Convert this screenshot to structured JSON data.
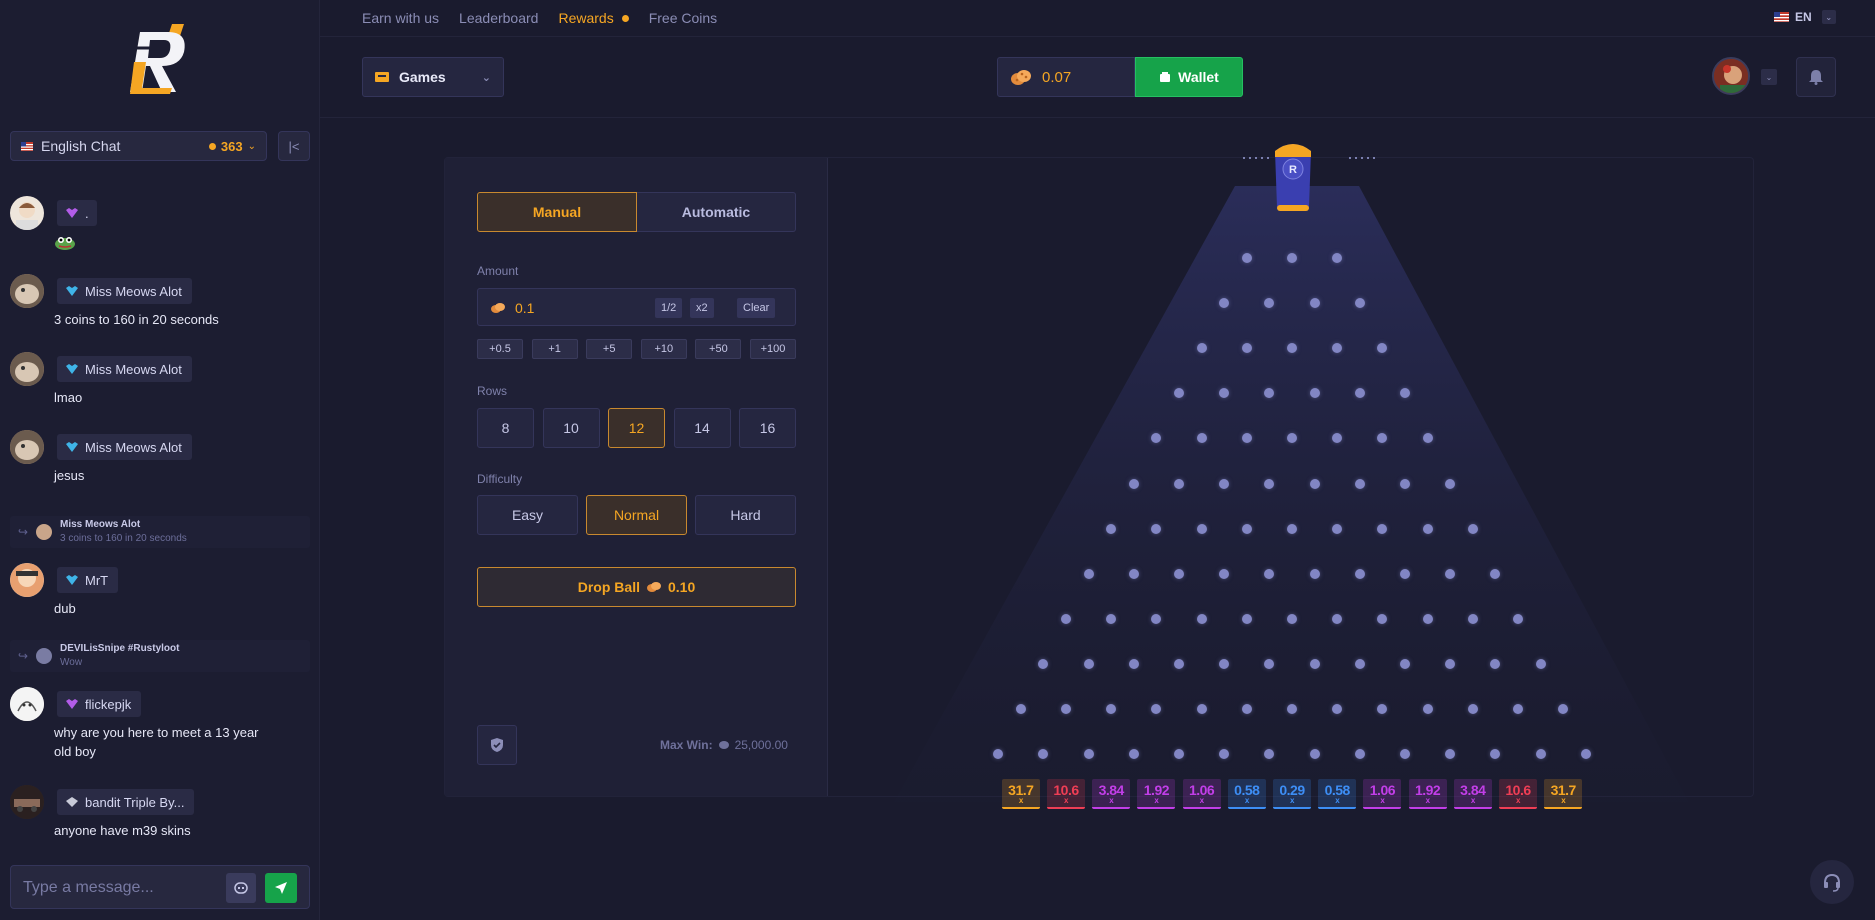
{
  "nav": {
    "links": [
      {
        "label": "Earn with us",
        "active": false
      },
      {
        "label": "Leaderboard",
        "active": false
      },
      {
        "label": "Rewards",
        "active": true
      },
      {
        "label": "Free Coins",
        "active": false
      }
    ],
    "language": "EN"
  },
  "header": {
    "games_label": "Games",
    "balance": "0.07",
    "wallet_label": "Wallet"
  },
  "chat": {
    "room_label": "English Chat",
    "online_count": "363",
    "input_placeholder": "Type a message...",
    "messages": [
      {
        "name": ".",
        "text": "",
        "badge": "purple"
      },
      {
        "name": "Miss Meows Alot",
        "text": "3 coins to 160 in 20 seconds",
        "badge": "blue"
      },
      {
        "name": "Miss Meows Alot",
        "text": "lmao",
        "badge": "blue"
      },
      {
        "name": "Miss Meows Alot",
        "text": "jesus",
        "badge": "blue"
      },
      {
        "name": "MrT",
        "text": "dub",
        "badge": "blue"
      },
      {
        "name": "flickepjk",
        "text": "why are you here to meet a 13 year old boy",
        "badge": "purple"
      },
      {
        "name": "bandit Triple By...",
        "text": "anyone have m39 skins",
        "badge": "gray"
      }
    ],
    "replies": [
      {
        "name": "Miss Meows Alot",
        "text": "3 coins to 160 in 20 seconds"
      },
      {
        "name": "DEVILisSnipe #Rustyloot",
        "text": "Wow"
      }
    ]
  },
  "controls": {
    "modes": [
      "Manual",
      "Automatic"
    ],
    "active_mode": "Manual",
    "amount_label": "Amount",
    "amount_value": "0.1",
    "half_label": "1/2",
    "double_label": "x2",
    "clear_label": "Clear",
    "quick_adds": [
      "+0.5",
      "+1",
      "+5",
      "+10",
      "+50",
      "+100"
    ],
    "rows_label": "Rows",
    "rows_options": [
      "8",
      "10",
      "12",
      "14",
      "16"
    ],
    "active_rows": "12",
    "difficulty_label": "Difficulty",
    "difficulty_options": [
      "Easy",
      "Normal",
      "Hard"
    ],
    "active_difficulty": "Normal",
    "drop_label": "Drop Ball",
    "drop_amount": "0.10",
    "max_win_label": "Max Win:",
    "max_win_value": "25,000.00"
  },
  "board": {
    "rows": 12,
    "multipliers": [
      "31.7",
      "10.6",
      "3.84",
      "1.92",
      "1.06",
      "0.58",
      "0.29",
      "0.58",
      "1.06",
      "1.92",
      "3.84",
      "10.6",
      "31.7"
    ],
    "multiplier_suffix": "x",
    "colors": {
      "31.7": "#f5a623",
      "10.6": "#ef3e55",
      "3.84": "#c23ee8",
      "1.92": "#c23ee8",
      "1.06": "#c23ee8",
      "0.58": "#3d8ef5",
      "0.29": "#3d8ef5"
    }
  },
  "colors": {
    "accent": "#f5a623",
    "wallet": "#16a34a",
    "background": "#1a1b2e"
  }
}
